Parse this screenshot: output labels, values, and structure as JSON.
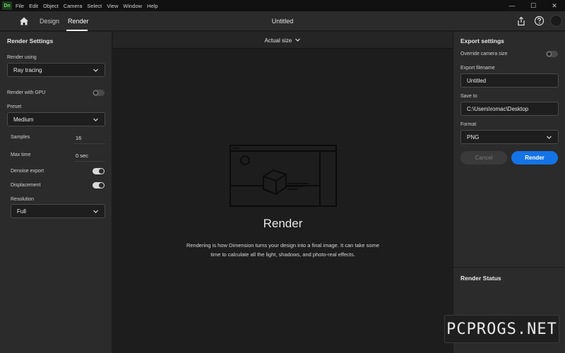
{
  "app": {
    "logo_text": "Dn",
    "menu": [
      "File",
      "Edit",
      "Object",
      "Camera",
      "Select",
      "View",
      "Window",
      "Help"
    ],
    "window_controls": [
      "—",
      "☐",
      "✕"
    ]
  },
  "header": {
    "tabs": {
      "design": "Design",
      "render": "Render"
    },
    "active_tab": "Render",
    "document_title": "Untitled"
  },
  "render_settings": {
    "title": "Render Settings",
    "render_using_label": "Render using",
    "render_using_value": "Ray tracing",
    "gpu_label": "Render with GPU",
    "gpu_on": false,
    "preset_label": "Preset",
    "preset_value": "Medium",
    "samples_label": "Samples",
    "samples_value": "16",
    "max_time_label": "Max time",
    "max_time_value": "0 sec",
    "denoise_label": "Denoise export",
    "denoise_on": true,
    "displacement_label": "Displacement",
    "displacement_on": true,
    "resolution_label": "Resolution",
    "resolution_value": "Full"
  },
  "canvas": {
    "zoom_label": "Actual size",
    "heading": "Render",
    "description": "Rendering is how Dimension turns your design into a final image. It can take some time to calculate all the light, shadows, and photo-real effects."
  },
  "export_settings": {
    "title": "Export settings",
    "override_label": "Override camera size",
    "override_on": false,
    "filename_label": "Export filename",
    "filename_value": "Untitled",
    "save_to_label": "Save to",
    "save_to_value": "C:\\Users\\romac\\Desktop",
    "format_label": "Format",
    "format_value": "PNG",
    "cancel_label": "Cancel",
    "render_label": "Render",
    "status_title": "Render Status"
  },
  "colors": {
    "accent": "#1473e6",
    "panel": "#2b2b2b",
    "canvas": "#1d1d1d"
  },
  "watermark": "PCPROGS.NET"
}
